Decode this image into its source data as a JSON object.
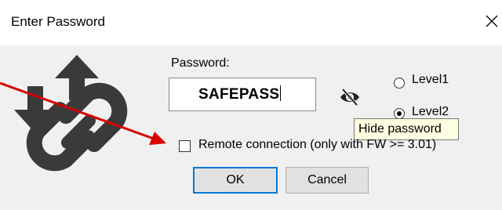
{
  "window": {
    "title": "Enter Password",
    "close_symbol": "×"
  },
  "form": {
    "password_label": "Password:",
    "password_value": "SAFEPASS",
    "visibility_icon": "eye-slash-icon",
    "level1_label": "Level1",
    "level2_label": "Level2",
    "level2_selected": true,
    "tooltip": "Hide password",
    "remote_label": "Remote connection (only with FW >= 3.01)",
    "remote_checked": false
  },
  "buttons": {
    "ok_label": "OK",
    "cancel_label": "Cancel"
  },
  "icons": {
    "logo": "chain-link-transfer-icon"
  },
  "colors": {
    "annotation_arrow": "#d80000",
    "logo": "#3a3a3a",
    "default_button_border": "#0078d7"
  }
}
